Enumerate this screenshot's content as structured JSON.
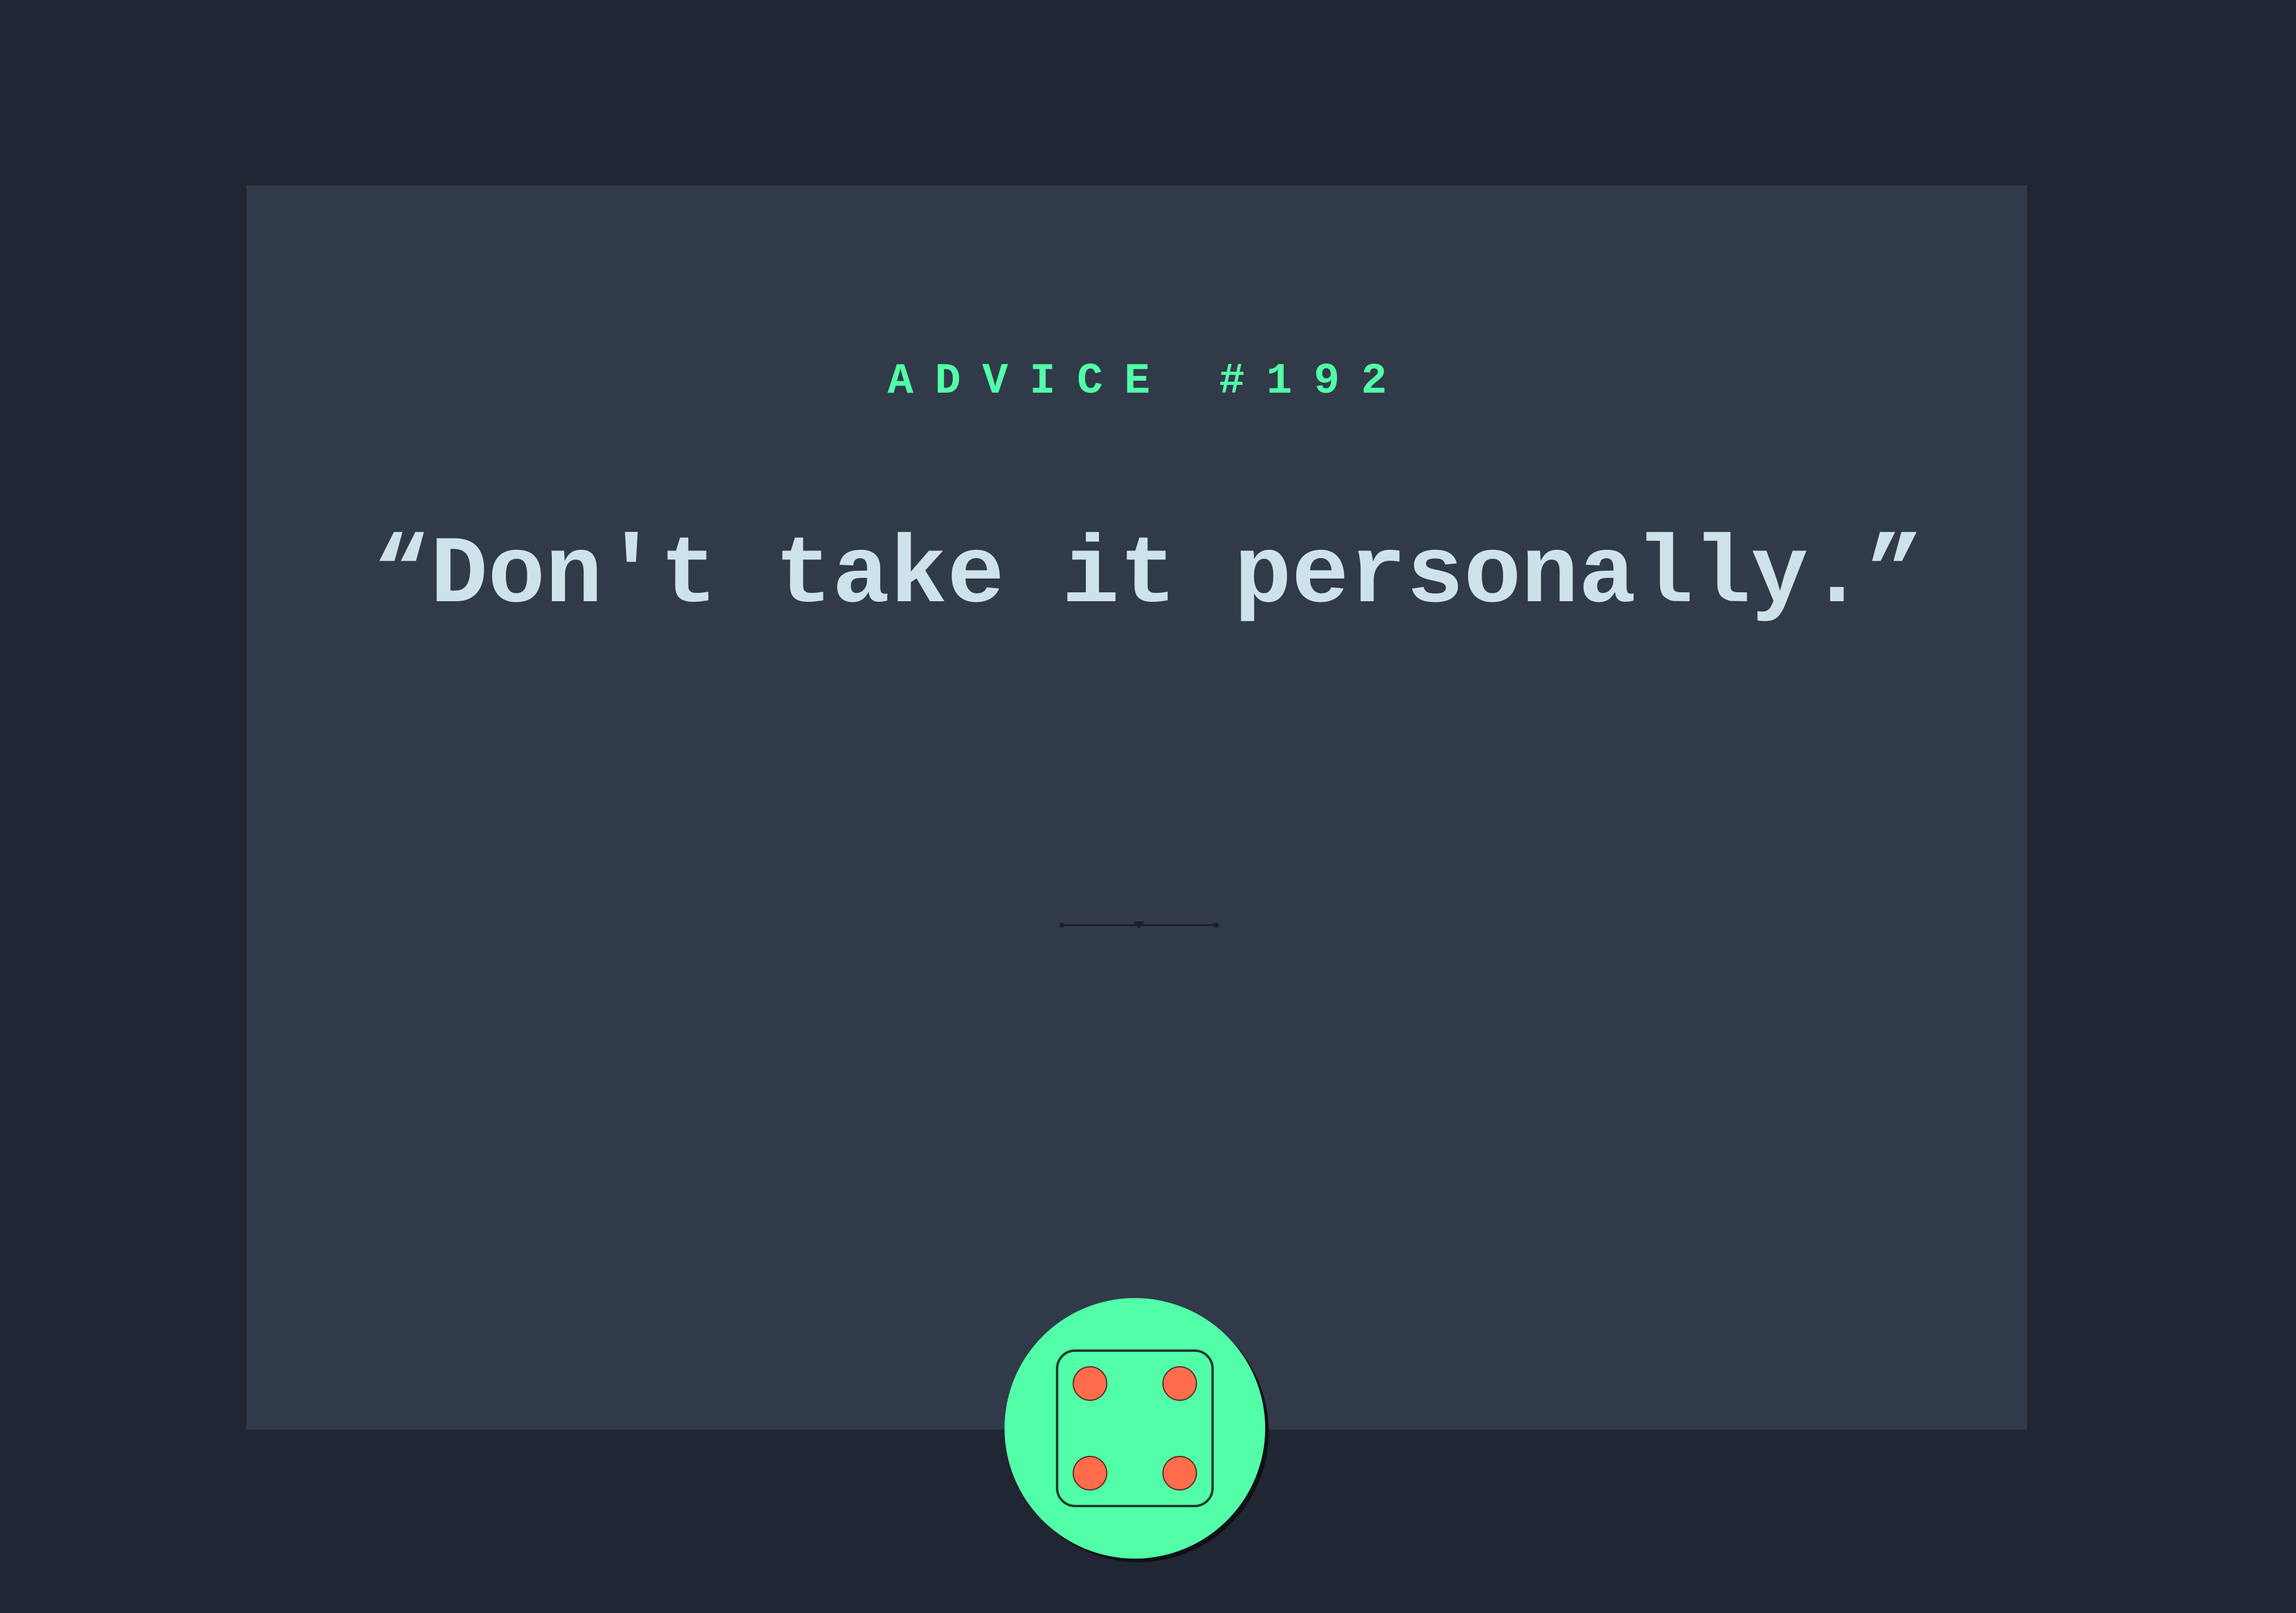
{
  "advice": {
    "label": "ADVICE #192",
    "quote": "“Don't take it personally.”"
  },
  "divider": {
    "icon": "pattern-divider-icon"
  },
  "dice_button": {
    "icon": "dice-icon",
    "face_value": 4
  },
  "colors": {
    "background": "#202632",
    "card": "#313a49",
    "accent_green": "#52ffa8",
    "quote_text": "#cee3e9",
    "dice_pips": "#ff6d4d"
  }
}
